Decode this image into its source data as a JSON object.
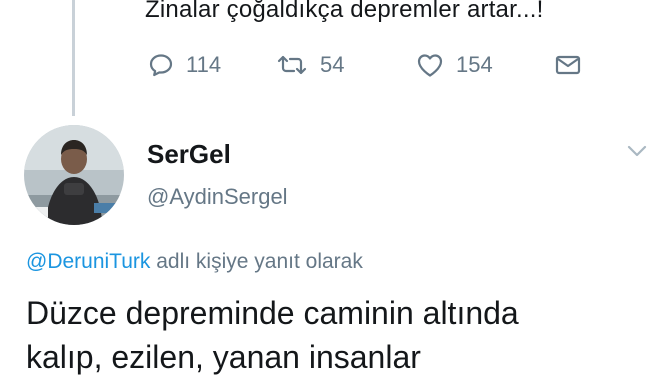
{
  "previous_tweet": {
    "text": "Zinalar çoğaldıkça depremler artar...!",
    "actions": {
      "reply_icon": "reply-icon",
      "reply_count": "114",
      "retweet_icon": "retweet-icon",
      "retweet_count": "54",
      "like_icon": "heart-icon",
      "like_count": "154",
      "dm_icon": "envelope-icon"
    }
  },
  "tweet": {
    "display_name": "SerGel",
    "username": "@AydinSergel",
    "menu_icon": "chevron-down-icon",
    "reply_context": {
      "mention": "@DeruniTurk",
      "suffix": " adlı kişiye yanıt olarak"
    },
    "text_lines": [
      "Düzce depreminde caminin altında",
      "kalıp,  ezilen, yanan insanlar"
    ]
  },
  "colors": {
    "text": "#14171a",
    "secondary": "#657786",
    "link": "#1b95e0",
    "thread_line": "#c9d1d8"
  }
}
